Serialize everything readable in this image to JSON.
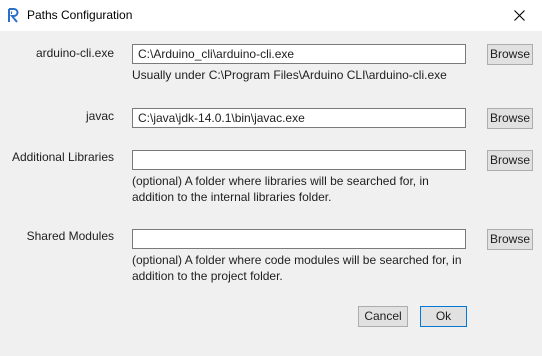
{
  "window": {
    "title": "Paths Configuration",
    "app_icon": "rider-logo-icon",
    "close_icon": "close-icon"
  },
  "fields": [
    {
      "label": "arduino-cli.exe",
      "value": "C:\\Arduino_cli\\arduino-cli.exe",
      "placeholder": "",
      "button": "Browse",
      "hint": "Usually under C:\\Program Files\\Arduino CLI\\arduino-cli.exe"
    },
    {
      "label": "javac",
      "value": "C:\\java\\jdk-14.0.1\\bin\\javac.exe",
      "placeholder": "",
      "button": "Browse",
      "hint": ""
    },
    {
      "label": "Additional Libraries",
      "value": "",
      "placeholder": "",
      "button": "Browse",
      "hint_line1": "(optional) A folder where libraries will be searched for, in",
      "hint_line2": "addition to the internal libraries folder."
    },
    {
      "label": "Shared Modules",
      "value": "",
      "placeholder": "",
      "button": "Browse",
      "hint_line1": "(optional) A folder where code modules will be searched for, in",
      "hint_line2": "addition to the project folder."
    }
  ],
  "footer": {
    "cancel_label": "Cancel",
    "ok_label": "Ok"
  },
  "colors": {
    "accent": "#0078d7",
    "window_bg": "#f0f0f0",
    "titlebar_bg": "#ffffff"
  }
}
